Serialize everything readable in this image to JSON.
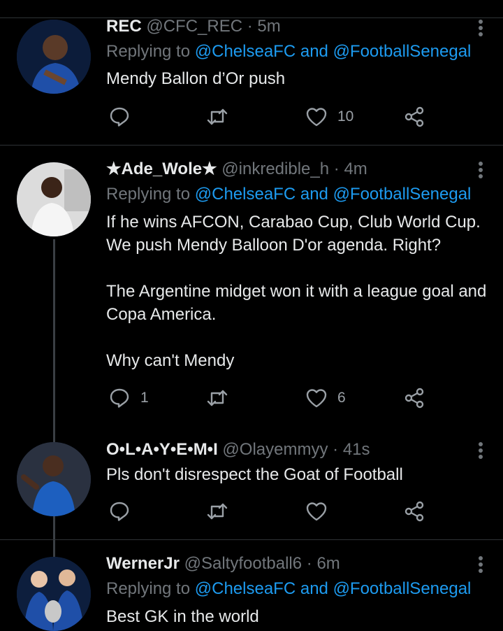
{
  "tweets": [
    {
      "name": "REC",
      "handle": "@CFC_REC",
      "time": "5m",
      "replying_prefix": "Replying to",
      "mention1": "@ChelseaFC",
      "and": "and",
      "mention2": "@FootballSenegal",
      "text": "Mendy Ballon d’Or push",
      "reply_count": "",
      "retweet_count": "",
      "like_count": "10"
    },
    {
      "name": "★Ade_Wole★",
      "handle": "@inkredible_h",
      "time": "4m",
      "replying_prefix": "Replying to",
      "mention1": "@ChelseaFC",
      "and": "and",
      "mention2": "@FootballSenegal",
      "text": "If he wins AFCON, Carabao Cup, Club World Cup. We push Mendy Balloon D'or agenda. Right?\n\nThe Argentine midget won it with a league goal and Copa America.\n\nWhy can't Mendy",
      "reply_count": "1",
      "retweet_count": "",
      "like_count": "6"
    },
    {
      "name": "O•L•A•Y•E•M•I",
      "handle": "@Olayemmyy",
      "time": "41s",
      "text": "Pls don't disrespect the Goat of Football",
      "reply_count": "",
      "retweet_count": "",
      "like_count": ""
    },
    {
      "name": "WernerJr",
      "handle": "@Saltyfootball6",
      "time": "6m",
      "replying_prefix": "Replying to",
      "mention1": "@ChelseaFC",
      "and": "and",
      "mention2": "@FootballSenegal",
      "text": "Best GK in the world"
    }
  ],
  "colors": {
    "background": "#000000",
    "mention": "#1d9bf0",
    "muted": "#71767b",
    "text": "#e7e9ea"
  },
  "icons": [
    "reply-icon",
    "retweet-icon",
    "like-icon",
    "share-icon",
    "more-icon"
  ]
}
